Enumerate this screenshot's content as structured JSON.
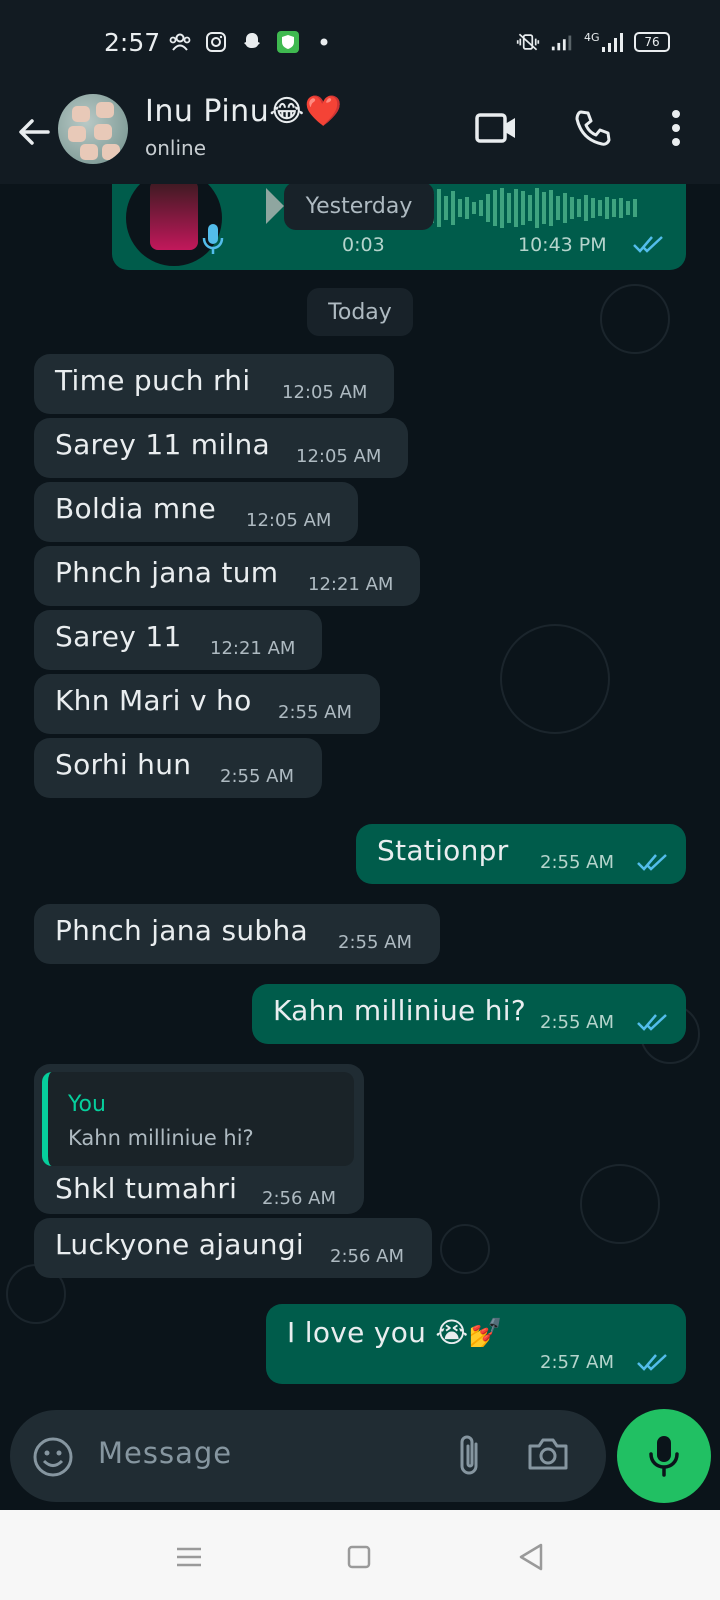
{
  "status_bar": {
    "time": "2:57",
    "battery": "76",
    "network": "4G"
  },
  "header": {
    "contact_name": "Inu Pinu😂❤️",
    "contact_status": "online"
  },
  "voice_note": {
    "duration": "0:03",
    "time": "10:43 PM"
  },
  "dates": {
    "yesterday": "Yesterday",
    "today": "Today"
  },
  "messages": [
    {
      "text": "Time puch rhi",
      "time": "12:05 AM",
      "dir": "in"
    },
    {
      "text": "Sarey 11 milna",
      "time": "12:05 AM",
      "dir": "in"
    },
    {
      "text": "Boldia mne",
      "time": "12:05 AM",
      "dir": "in"
    },
    {
      "text": "Phnch jana tum",
      "time": "12:21 AM",
      "dir": "in"
    },
    {
      "text": "Sarey 11",
      "time": "12:21 AM",
      "dir": "in"
    },
    {
      "text": "Khn Mari v ho",
      "time": "2:55 AM",
      "dir": "in"
    },
    {
      "text": "Sorhi hun",
      "time": "2:55 AM",
      "dir": "in"
    },
    {
      "text": "Stationpr",
      "time": "2:55 AM",
      "dir": "out"
    },
    {
      "text": "Phnch jana subha",
      "time": "2:55 AM",
      "dir": "in"
    },
    {
      "text": "Kahn milliniue hi?",
      "time": "2:55 AM",
      "dir": "out"
    },
    {
      "text": "Shkl tumahri",
      "time": "2:56 AM",
      "dir": "in"
    },
    {
      "text": "Luckyone ajaungi",
      "time": "2:56 AM",
      "dir": "in"
    },
    {
      "text": "I love you 😭💅",
      "time": "2:57 AM",
      "dir": "out"
    }
  ],
  "reply": {
    "author": "You",
    "quoted_text": "Kahn milliniue hi?"
  },
  "input": {
    "placeholder": "Message"
  },
  "colors": {
    "background": "#0b141a",
    "header": "#121b22",
    "incoming_bubble": "#202c33",
    "outgoing_bubble": "#005c4b",
    "accent": "#21c063",
    "read_ticks": "#53bdeb"
  },
  "icons": [
    "back-arrow-icon",
    "video-call-icon",
    "phone-icon",
    "more-options-icon",
    "emoji-icon",
    "attach-icon",
    "camera-icon",
    "mic-icon",
    "menu-nav-icon",
    "home-nav-icon",
    "back-nav-icon"
  ]
}
